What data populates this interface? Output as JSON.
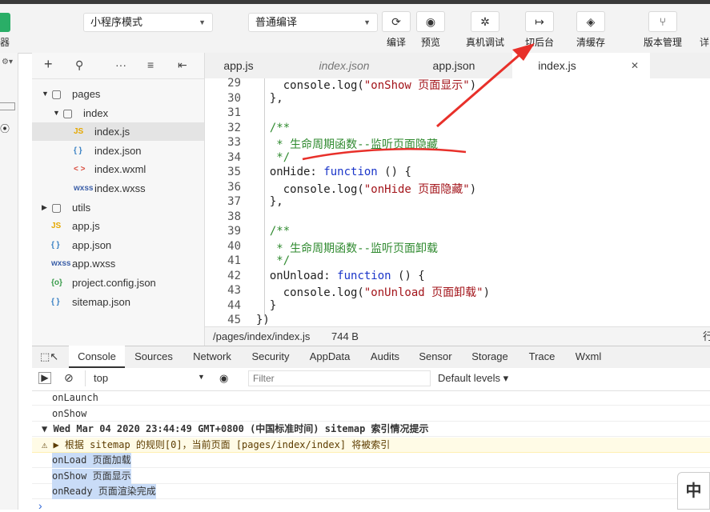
{
  "toolbar": {
    "left_label": "器",
    "mode_select": "小程序模式",
    "compile_select": "普通编译",
    "tools": [
      {
        "icon": "refresh-icon",
        "glyph": "⟳",
        "label": "编译"
      },
      {
        "icon": "eye-icon",
        "glyph": "◉",
        "label": "预览"
      },
      {
        "icon": "bug-icon",
        "glyph": "✲",
        "label": "真机调试"
      },
      {
        "icon": "switch-icon",
        "glyph": "↦",
        "label": "切后台"
      },
      {
        "icon": "layers-icon",
        "glyph": "◈",
        "label": "清缓存"
      },
      {
        "icon": "branch-icon",
        "glyph": "⑂",
        "label": "版本管理"
      }
    ],
    "right_partial": "详"
  },
  "file_tree": [
    {
      "label": "pages",
      "icon": "folder-icon",
      "glyph": "▢",
      "arrow": "▼",
      "depth": 0
    },
    {
      "label": "index",
      "icon": "folder-icon",
      "glyph": "▢",
      "arrow": "▼",
      "depth": 1
    },
    {
      "label": "index.js",
      "icon": "js-icon",
      "glyph": "JS",
      "arrow": "",
      "depth": 2,
      "selected": true
    },
    {
      "label": "index.json",
      "icon": "json-icon",
      "glyph": "{ }",
      "arrow": "",
      "depth": 2
    },
    {
      "label": "index.wxml",
      "icon": "wxml-icon",
      "glyph": "< >",
      "arrow": "",
      "depth": 2
    },
    {
      "label": "index.wxss",
      "icon": "wxss-icon",
      "glyph": "wxss",
      "arrow": "",
      "depth": 2
    },
    {
      "label": "utils",
      "icon": "folder-icon",
      "glyph": "▢",
      "arrow": "▶",
      "depth": 0
    },
    {
      "label": "app.js",
      "icon": "js-icon",
      "glyph": "JS",
      "arrow": "",
      "depth": 0
    },
    {
      "label": "app.json",
      "icon": "json-icon",
      "glyph": "{ }",
      "arrow": "",
      "depth": 0
    },
    {
      "label": "app.wxss",
      "icon": "wxss-icon",
      "glyph": "wxss",
      "arrow": "",
      "depth": 0
    },
    {
      "label": "project.config.json",
      "icon": "config-icon",
      "glyph": "{o}",
      "arrow": "",
      "depth": 0
    },
    {
      "label": "sitemap.json",
      "icon": "json-icon",
      "glyph": "{ }",
      "arrow": "",
      "depth": 0
    }
  ],
  "tabs": [
    {
      "label": "app.js",
      "italic": false
    },
    {
      "label": "index.json",
      "italic": true
    },
    {
      "label": "app.json",
      "italic": false
    },
    {
      "label": "index.js",
      "italic": false,
      "active": true,
      "close": "✕"
    }
  ],
  "code": [
    {
      "n": "29",
      "t": "    console.log(\"onShow 页面显示\")"
    },
    {
      "n": "30",
      "t": "  },"
    },
    {
      "n": "31",
      "t": ""
    },
    {
      "n": "32",
      "t": "  /**"
    },
    {
      "n": "33",
      "t": "   * 生命周期函数--监听页面隐藏"
    },
    {
      "n": "34",
      "t": "   */"
    },
    {
      "n": "35",
      "t": "  onHide: function () {"
    },
    {
      "n": "36",
      "t": "    console.log(\"onHide 页面隐藏\")"
    },
    {
      "n": "37",
      "t": "  },"
    },
    {
      "n": "38",
      "t": ""
    },
    {
      "n": "39",
      "t": "  /**"
    },
    {
      "n": "40",
      "t": "   * 生命周期函数--监听页面卸载"
    },
    {
      "n": "41",
      "t": "   */"
    },
    {
      "n": "42",
      "t": "  onUnload: function () {"
    },
    {
      "n": "43",
      "t": "    console.log(\"onUnload 页面卸载\")"
    },
    {
      "n": "44",
      "t": "  }"
    },
    {
      "n": "45",
      "t": "})"
    }
  ],
  "status": {
    "path": "/pages/index/index.js",
    "size": "744 B",
    "right_partial": "行"
  },
  "devtools_tabs": [
    "Console",
    "Sources",
    "Network",
    "Security",
    "AppData",
    "Audits",
    "Sensor",
    "Storage",
    "Trace",
    "Wxml"
  ],
  "filter": {
    "context": "top",
    "placeholder": "Filter",
    "levels": "Default levels ▾"
  },
  "console_lines": [
    {
      "text": "onLaunch",
      "type": "log"
    },
    {
      "text": "onShow",
      "type": "log"
    },
    {
      "text": "▼ Wed Mar 04 2020 23:44:49 GMT+0800 (中国标准时间) sitemap 索引情况提示",
      "type": "group"
    },
    {
      "text": "⚠ ▶ 根据 sitemap 的规则[0]，当前页面 [pages/index/index] 将被索引",
      "type": "warn"
    },
    {
      "text": "onLoad 页面加载",
      "type": "hl"
    },
    {
      "text": "onShow 页面显示",
      "type": "hl"
    },
    {
      "text": "onReady 页面渲染完成",
      "type": "hl"
    }
  ],
  "prompt": "›",
  "ime": "中",
  "colors": {
    "accent_green": "#2aae67",
    "annotation_red": "#e8302a",
    "keyword": "#1a35c9",
    "string": "#a3151b",
    "comment": "#2f8a2f"
  }
}
